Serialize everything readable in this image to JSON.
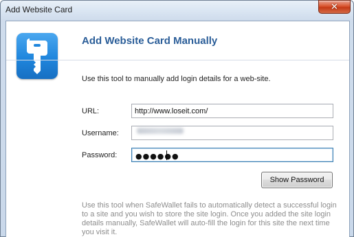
{
  "window": {
    "title": "Add Website Card",
    "close_glyph": "✕"
  },
  "header": {
    "heading": "Add Website Card Manually",
    "icon": "key-icon",
    "icon_color": "#1f86dd",
    "heading_color": "#2a5d98"
  },
  "intro": "Use this tool to manually add login details for a web-site.",
  "form": {
    "url": {
      "label": "URL:",
      "value": "http://www.loseit.com/"
    },
    "username": {
      "label": "Username:",
      "value": ""
    },
    "password": {
      "label": "Password:",
      "masked": "●●●●●●"
    }
  },
  "buttons": {
    "show_password": "Show Password"
  },
  "help_text": "Use this tool when SafeWallet fails to automatically detect a successful login to a site and you wish to store the site login. Once you added the site login details manually, SafeWallet will auto-fill the login for this site the next time you visit it."
}
